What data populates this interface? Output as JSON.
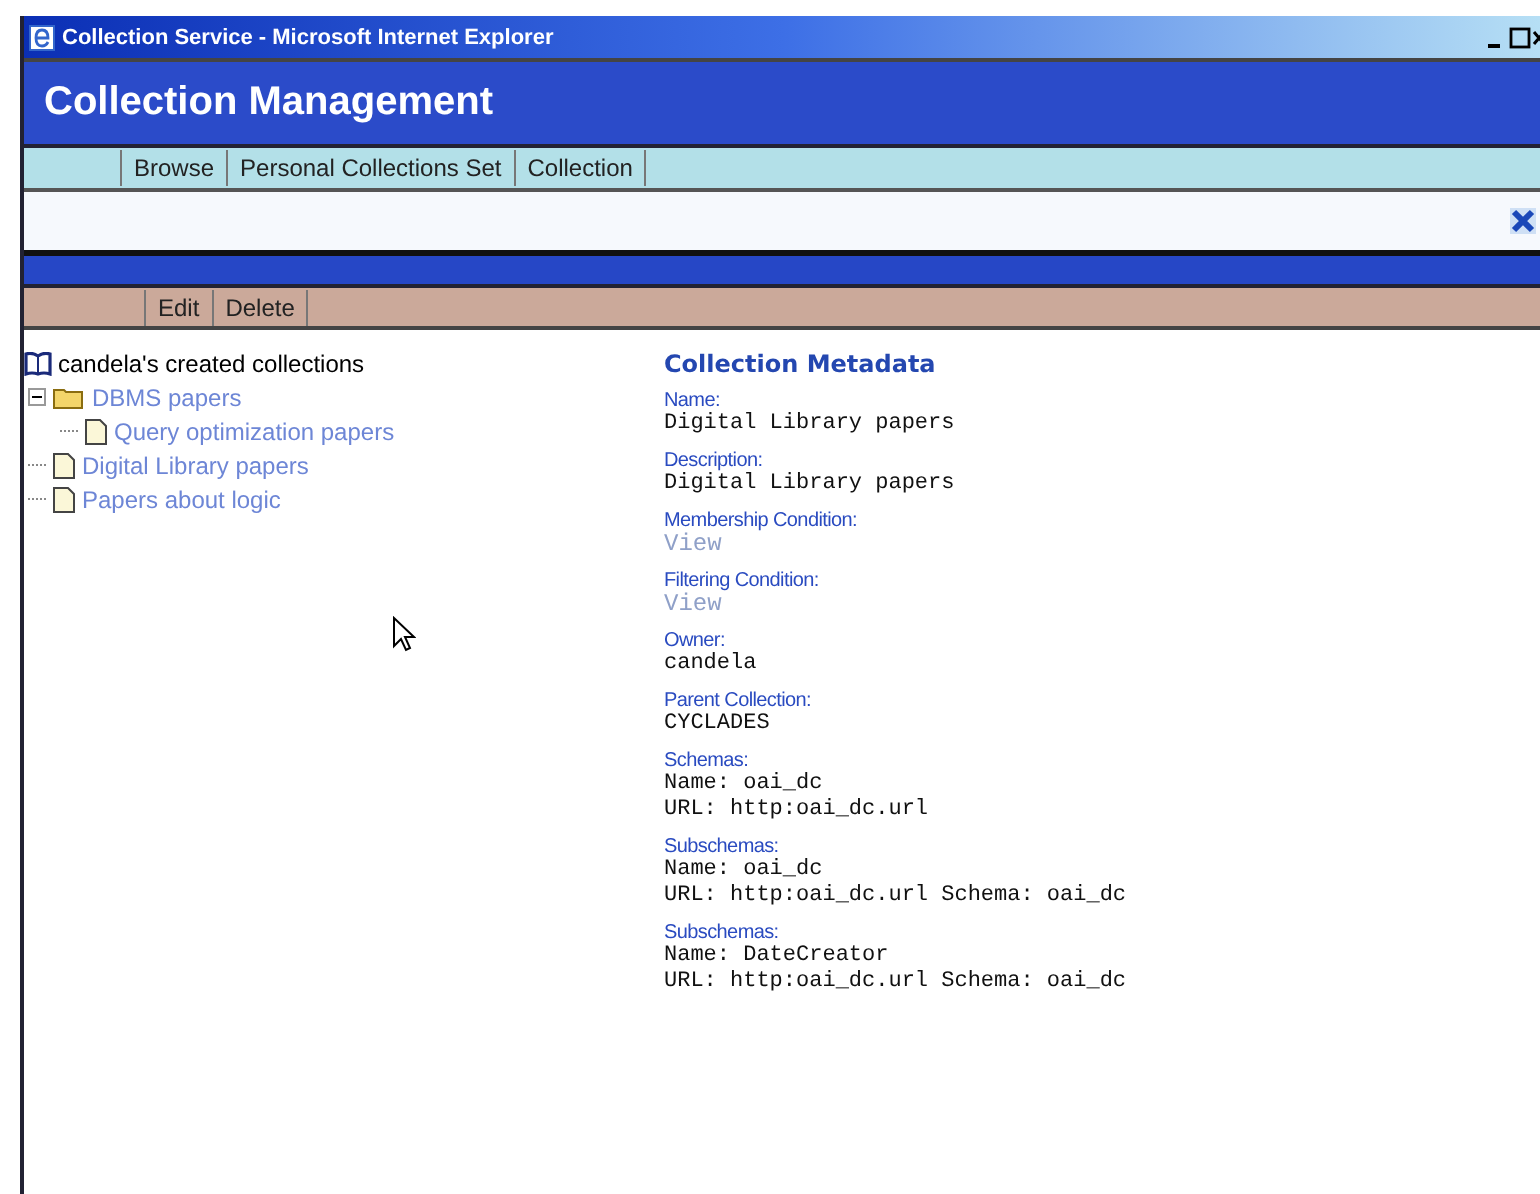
{
  "window": {
    "title": "Collection Service - Microsoft Internet Explorer"
  },
  "header": {
    "title": "Collection Management"
  },
  "nav": {
    "items": [
      "Browse",
      "Personal Collections Set",
      "Collection"
    ]
  },
  "actions": {
    "items": [
      "Edit",
      "Delete"
    ]
  },
  "tree": {
    "root": "candela's created collections",
    "children": [
      {
        "label": "DBMS papers",
        "kind": "folder",
        "expanded": true,
        "children": [
          {
            "label": "Query optimization papers",
            "kind": "document"
          }
        ]
      },
      {
        "label": "Digital Library papers",
        "kind": "document"
      },
      {
        "label": "Papers about logic",
        "kind": "document"
      }
    ]
  },
  "metadata": {
    "title": "Collection Metadata",
    "fields": [
      {
        "label": "Name:",
        "kind": "text",
        "lines": [
          "Digital Library papers"
        ]
      },
      {
        "label": "Description:",
        "kind": "text",
        "lines": [
          "Digital Library papers"
        ]
      },
      {
        "label": "Membership Condition:",
        "kind": "link",
        "lines": [
          "View"
        ]
      },
      {
        "label": "Filtering Condition:",
        "kind": "link",
        "lines": [
          "View"
        ]
      },
      {
        "label": "Owner:",
        "kind": "text",
        "lines": [
          "candela"
        ]
      },
      {
        "label": "Parent Collection:",
        "kind": "text",
        "lines": [
          "CYCLADES"
        ]
      },
      {
        "label": "Schemas:",
        "kind": "text",
        "lines": [
          "Name: oai_dc",
          "URL: http:oai_dc.url"
        ]
      },
      {
        "label": "Subschemas:",
        "kind": "text",
        "lines": [
          "Name: oai_dc",
          "URL: http:oai_dc.url Schema: oai_dc"
        ]
      },
      {
        "label": "Subschemas:",
        "kind": "text",
        "lines": [
          "Name: DateCreator",
          "URL: http:oai_dc.url Schema: oai_dc"
        ]
      }
    ]
  }
}
